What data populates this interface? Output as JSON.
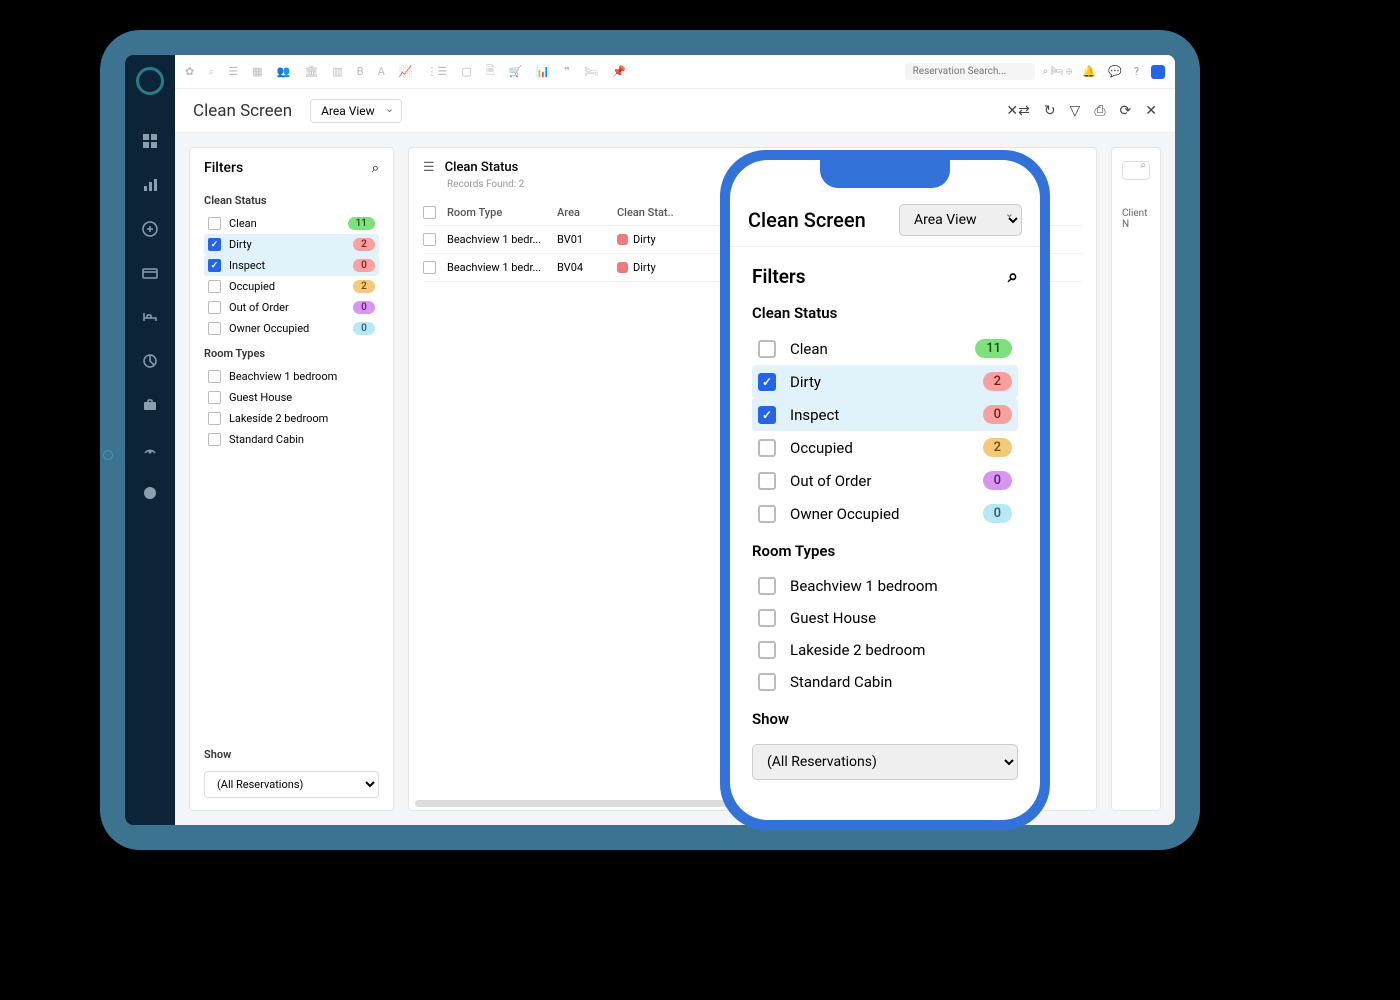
{
  "page_title": "Clean Screen",
  "view_select": "Area View",
  "search_placeholder": "Reservation Search...",
  "filters": {
    "title": "Filters",
    "clean_status_label": "Clean Status",
    "statuses": [
      {
        "label": "Clean",
        "count": "11",
        "badge": "b-green",
        "checked": false
      },
      {
        "label": "Dirty",
        "count": "2",
        "badge": "b-red",
        "checked": true
      },
      {
        "label": "Inspect",
        "count": "0",
        "badge": "b-red",
        "checked": true
      },
      {
        "label": "Occupied",
        "count": "2",
        "badge": "b-orange",
        "checked": false
      },
      {
        "label": "Out of Order",
        "count": "0",
        "badge": "b-purple",
        "checked": false
      },
      {
        "label": "Owner Occupied",
        "count": "0",
        "badge": "b-cyan",
        "checked": false
      }
    ],
    "room_types_label": "Room Types",
    "room_types": [
      {
        "label": "Beachview 1 bedroom"
      },
      {
        "label": "Guest House"
      },
      {
        "label": "Lakeside 2 bedroom"
      },
      {
        "label": "Standard Cabin"
      }
    ],
    "show_label": "Show",
    "show_value": "(All Reservations)"
  },
  "results": {
    "title": "Clean Status",
    "records_found": "Records Found: 2",
    "columns": {
      "room_type": "Room Type",
      "area": "Area",
      "clean_status": "Clean Stat..",
      "client": "Client N"
    },
    "rows": [
      {
        "room_type": "Beachview 1 bedr...",
        "area": "BV01",
        "status": "Dirty"
      },
      {
        "room_type": "Beachview 1 bedr...",
        "area": "BV04",
        "status": "Dirty"
      }
    ]
  }
}
